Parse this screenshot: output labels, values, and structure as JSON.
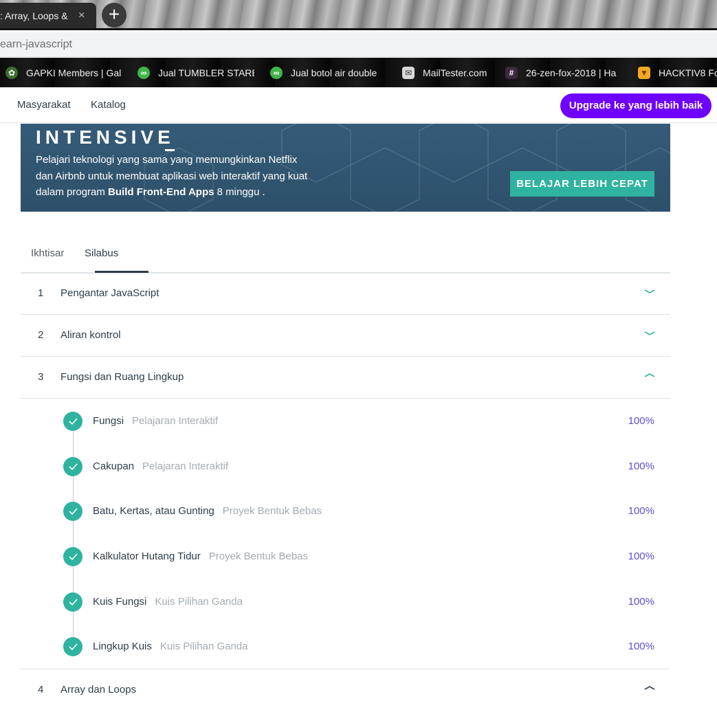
{
  "browser": {
    "tab_title": ": Array, Loops &",
    "tab_close": "×",
    "new_tab": "+",
    "url_fragment": "earn-javascript",
    "bookmarks": [
      {
        "label": "GAPKI Members | Gal",
        "icon": "gapki-icon",
        "icon_color": "#2e7d32"
      },
      {
        "label": "Jual TUMBLER STARB",
        "icon": "tokopedia-icon",
        "icon_color": "#42b549"
      },
      {
        "label": "Jual botol air double",
        "icon": "tokopedia-icon",
        "icon_color": "#42b549"
      },
      {
        "label": "MailTester.com",
        "icon": "mailtester-icon",
        "icon_color": "#cccccc"
      },
      {
        "label": "26-zen-fox-2018 | Ha",
        "icon": "slack-hash-icon",
        "icon_color": "#4a154b"
      },
      {
        "label": "HACKTIV8 Fo",
        "icon": "hacktiv8-fox-icon",
        "icon_color": "#f5a623"
      }
    ]
  },
  "nav": {
    "community": "Masyarakat",
    "catalog": "Katalog",
    "upgrade": "Upgrade ke yang lebih baik",
    "upgrade_color": "#6f00ff"
  },
  "banner": {
    "title": "INTENSIVE",
    "text_before": "Pelajari teknologi yang sama yang memungkinkan Netflix dan Airbnb untuk membuat aplikasi web interaktif yang kuat dalam program ",
    "text_bold": "Build Front-End Apps",
    "text_after": " 8 minggu .",
    "cta": "BELAJAR LEBIH CEPAT",
    "cta_color": "#2fb3a0"
  },
  "tabs": {
    "overview": "Ikhtisar",
    "syllabus": "Silabus"
  },
  "lessons": [
    {
      "num": "1",
      "title": "Pengantar JavaScript",
      "state": "collapsed"
    },
    {
      "num": "2",
      "title": "Aliran kontrol",
      "state": "collapsed"
    },
    {
      "num": "3",
      "title": "Fungsi dan Ruang Lingkup",
      "state": "expanded"
    },
    {
      "num": "4",
      "title": "Array dan Loops",
      "state": "expanded"
    }
  ],
  "concepts": [
    {
      "title": "Fungsi",
      "type": "Pelajaran Interaktif",
      "progress": "100%"
    },
    {
      "title": "Cakupan",
      "type": "Pelajaran Interaktif",
      "progress": "100%"
    },
    {
      "title": "Batu, Kertas, atau Gunting",
      "type": "Proyek Bentuk Bebas",
      "progress": "100%"
    },
    {
      "title": "Kalkulator Hutang Tidur",
      "type": "Proyek Bentuk Bebas",
      "progress": "100%"
    },
    {
      "title": "Kuis Fungsi",
      "type": "Kuis Pilihan Ganda",
      "progress": "100%"
    },
    {
      "title": "Lingkup Kuis",
      "type": "Kuis Pilihan Ganda",
      "progress": "100%"
    }
  ],
  "colors": {
    "accent_teal": "#2fb3a0",
    "progress_purple": "#5a4fcf",
    "text_dark": "#2e3d49"
  }
}
